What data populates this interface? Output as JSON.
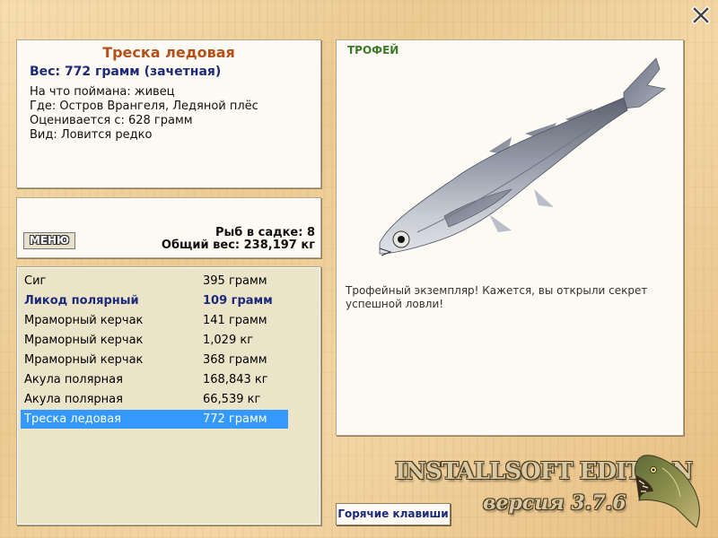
{
  "info": {
    "title": "Треска ледовая",
    "weight": "Вес: 772 грамм (зачетная)",
    "details": [
      "На что поймана: живец",
      "Где: Остров Врангеля, Ледяной плёс",
      "Оценивается с: 628 грамм",
      "Вид: Ловится редко"
    ]
  },
  "stats": {
    "menu_label": "МЕНЮ",
    "fish_count": "Рыб в садке: 8",
    "total_weight": "Общий вес: 238,197 кг"
  },
  "catch_list": [
    {
      "name": "Сиг",
      "weight": "395 грамм",
      "style": "normal"
    },
    {
      "name": "Ликод полярный",
      "weight": "109 грамм",
      "style": "bold"
    },
    {
      "name": "Мраморный керчак",
      "weight": "141 грамм",
      "style": "normal"
    },
    {
      "name": "Мраморный керчак",
      "weight": "1,029 кг",
      "style": "normal"
    },
    {
      "name": "Мраморный керчак",
      "weight": "368 грамм",
      "style": "normal"
    },
    {
      "name": "Акула полярная",
      "weight": "168,843 кг",
      "style": "normal"
    },
    {
      "name": "Акула полярная",
      "weight": "66,539 кг",
      "style": "normal"
    },
    {
      "name": "Треска ледовая",
      "weight": "772 грамм",
      "style": "selected"
    }
  ],
  "trophy": {
    "label": "ТРОФЕЙ",
    "message": "Трофейный экземпляр! Кажется, вы открыли секрет успешной ловли!"
  },
  "footer": {
    "hotkeys_label": "Горячие клавиши",
    "edition": "INSTALLSOFT EDITION",
    "version": "версия 3.7.6"
  },
  "colors": {
    "title": "#b4501a",
    "accent_blue": "#1d2a7a",
    "selection": "#3399ff",
    "trophy_green": "#3f7a2a",
    "panel_bg": "#fcfaf3",
    "list_bg": "#ebe4c8"
  },
  "icons": {
    "close": "close-icon",
    "fish": "fish-image",
    "logo": "pike-logo-icon"
  }
}
